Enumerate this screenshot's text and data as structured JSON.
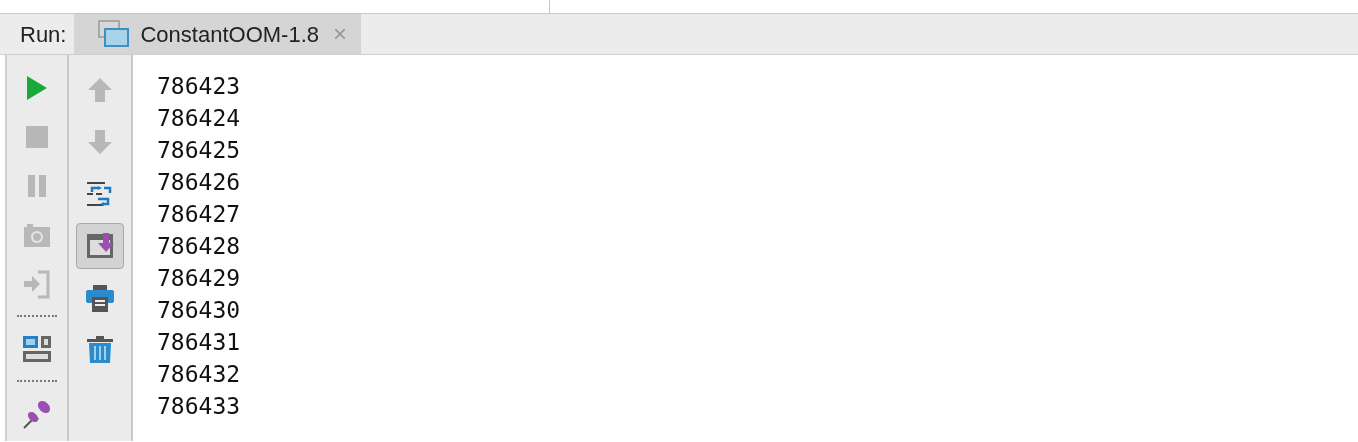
{
  "run_label": "Run:",
  "tabs": [
    {
      "label": "ConstantOOM-1.8",
      "close": "×",
      "selected": true
    }
  ],
  "left_tools": [
    {
      "kind": "run",
      "disabled": false
    },
    {
      "kind": "stop",
      "disabled": true
    },
    {
      "kind": "pause",
      "disabled": true
    },
    {
      "kind": "camera",
      "disabled": true
    },
    {
      "kind": "exit",
      "disabled": true
    },
    {
      "kind": "separator"
    },
    {
      "kind": "layout",
      "disabled": false
    },
    {
      "kind": "separator"
    },
    {
      "kind": "pin",
      "disabled": false
    }
  ],
  "right_tools": [
    {
      "kind": "up",
      "disabled": true,
      "pressed": false
    },
    {
      "kind": "down",
      "disabled": true,
      "pressed": false
    },
    {
      "kind": "wrap",
      "disabled": false,
      "pressed": false
    },
    {
      "kind": "scroll_end",
      "disabled": false,
      "pressed": true
    },
    {
      "kind": "print",
      "disabled": false,
      "pressed": false
    },
    {
      "kind": "trash",
      "disabled": false,
      "pressed": false
    }
  ],
  "console_lines": [
    "786423",
    "786424",
    "786425",
    "786426",
    "786427",
    "786428",
    "786429",
    "786430",
    "786431",
    "786432",
    "786433"
  ]
}
